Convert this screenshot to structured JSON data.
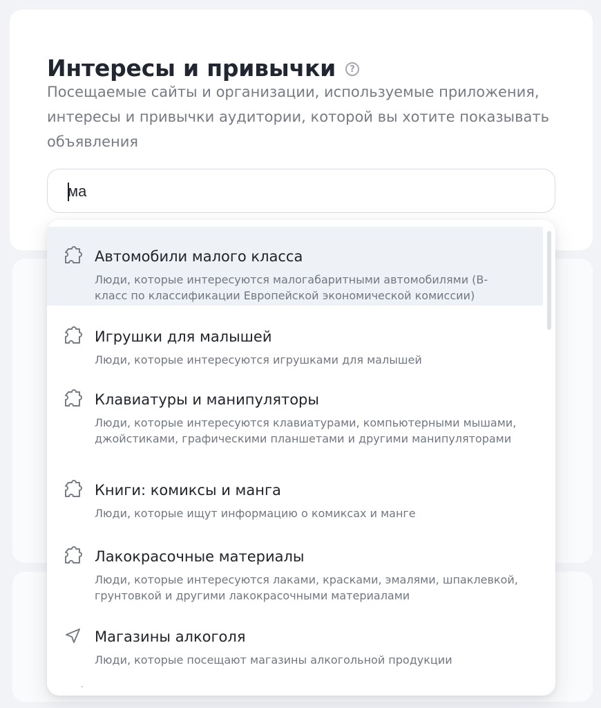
{
  "section": {
    "title": "Интересы и привычки",
    "help_icon": "question-circle-icon",
    "description": "Посещаемые сайты и организации, используемые приложения, интересы и привычки аудитории, которой вы хотите показывать объявления"
  },
  "search": {
    "value": "ма",
    "placeholder": ""
  },
  "dropdown": {
    "items": [
      {
        "title": "Автомобили малого класса",
        "description": "Люди, которые интересуются малогабаритными автомобилями (В-класс по классификации Европейской экономической комиссии)",
        "icon": "puzzle-icon",
        "selected": true
      },
      {
        "title": "Игрушки для малышей",
        "description": "Люди, которые интересуются игрушками для малышей",
        "icon": "puzzle-icon",
        "selected": false
      },
      {
        "title": "Клавиатуры и манипуляторы",
        "description": "Люди, которые интересуются клавиатурами, компьютерными мышами, джойстиками, графическими планшетами и другими манипуляторами",
        "icon": "puzzle-icon",
        "selected": false
      },
      {
        "title": "Книги: комиксы и манга",
        "description": "Люди, которые ищут информацию о комиксах и манге",
        "icon": "puzzle-icon",
        "selected": false
      },
      {
        "title": "Лакокрасочные материалы",
        "description": "Люди, которые интересуются лаками, красками, эмалями, шпаклевкой, грунтовкой и другими лакокрасочными материалами",
        "icon": "puzzle-icon",
        "selected": false
      },
      {
        "title": "Магазины алкоголя",
        "description": "Люди, которые посещают магазины алкогольной продукции",
        "icon": "location-arrow-icon",
        "selected": false
      }
    ]
  },
  "colors": {
    "background": "#f1f3f7",
    "card": "#ffffff",
    "selected_item": "#eef1f5",
    "text_primary": "#20242b",
    "text_secondary": "#717781"
  }
}
